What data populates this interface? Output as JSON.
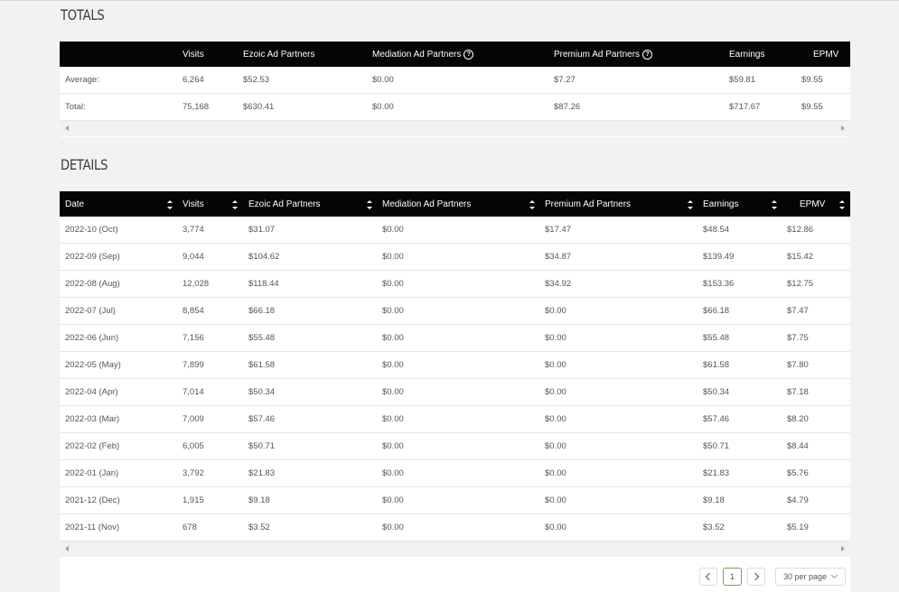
{
  "totals": {
    "title": "TOTALS",
    "headers": [
      "",
      "Visits",
      "Ezoic Ad Partners",
      "Mediation Ad Partners",
      "Premium Ad Partners",
      "Earnings",
      "EPMV"
    ],
    "rows": [
      [
        "Average:",
        "6,264",
        "$52.53",
        "$0.00",
        "$7.27",
        "$59.81",
        "$9.55"
      ],
      [
        "Total:",
        "75,168",
        "$630.41",
        "$0.00",
        "$87.26",
        "$717.67",
        "$9.55"
      ]
    ]
  },
  "details": {
    "title": "DETAILS",
    "headers": [
      "Date",
      "Visits",
      "Ezoic Ad Partners",
      "Mediation Ad Partners",
      "Premium Ad Partners",
      "Earnings",
      "EPMV"
    ],
    "rows": [
      [
        "2022-10 (Oct)",
        "3,774",
        "$31.07",
        "$0.00",
        "$17.47",
        "$48.54",
        "$12.86"
      ],
      [
        "2022-09 (Sep)",
        "9,044",
        "$104.62",
        "$0.00",
        "$34.87",
        "$139.49",
        "$15.42"
      ],
      [
        "2022-08 (Aug)",
        "12,028",
        "$118.44",
        "$0.00",
        "$34.92",
        "$153.36",
        "$12.75"
      ],
      [
        "2022-07 (Jul)",
        "8,854",
        "$66.18",
        "$0.00",
        "$0.00",
        "$66.18",
        "$7.47"
      ],
      [
        "2022-06 (Jun)",
        "7,156",
        "$55.48",
        "$0.00",
        "$0.00",
        "$55.48",
        "$7.75"
      ],
      [
        "2022-05 (May)",
        "7,899",
        "$61.58",
        "$0.00",
        "$0.00",
        "$61.58",
        "$7.80"
      ],
      [
        "2022-04 (Apr)",
        "7,014",
        "$50.34",
        "$0.00",
        "$0.00",
        "$50.34",
        "$7.18"
      ],
      [
        "2022-03 (Mar)",
        "7,009",
        "$57.46",
        "$0.00",
        "$0.00",
        "$57.46",
        "$8.20"
      ],
      [
        "2022-02 (Feb)",
        "6,005",
        "$50.71",
        "$0.00",
        "$0.00",
        "$50.71",
        "$8.44"
      ],
      [
        "2022-01 (Jan)",
        "3,792",
        "$21.83",
        "$0.00",
        "$0.00",
        "$21.83",
        "$5.76"
      ],
      [
        "2021-12 (Dec)",
        "1,915",
        "$9.18",
        "$0.00",
        "$0.00",
        "$9.18",
        "$4.79"
      ],
      [
        "2021-11 (Nov)",
        "678",
        "$3.52",
        "$0.00",
        "$0.00",
        "$3.52",
        "$5.19"
      ]
    ]
  },
  "pagination": {
    "current_page": "1",
    "per_page": "30 per page"
  },
  "icons": {
    "help": "question-circle-icon",
    "sort": "sort-icon",
    "prev": "chevron-left-icon",
    "next": "chevron-right-icon",
    "dropdown": "chevron-down-icon"
  }
}
